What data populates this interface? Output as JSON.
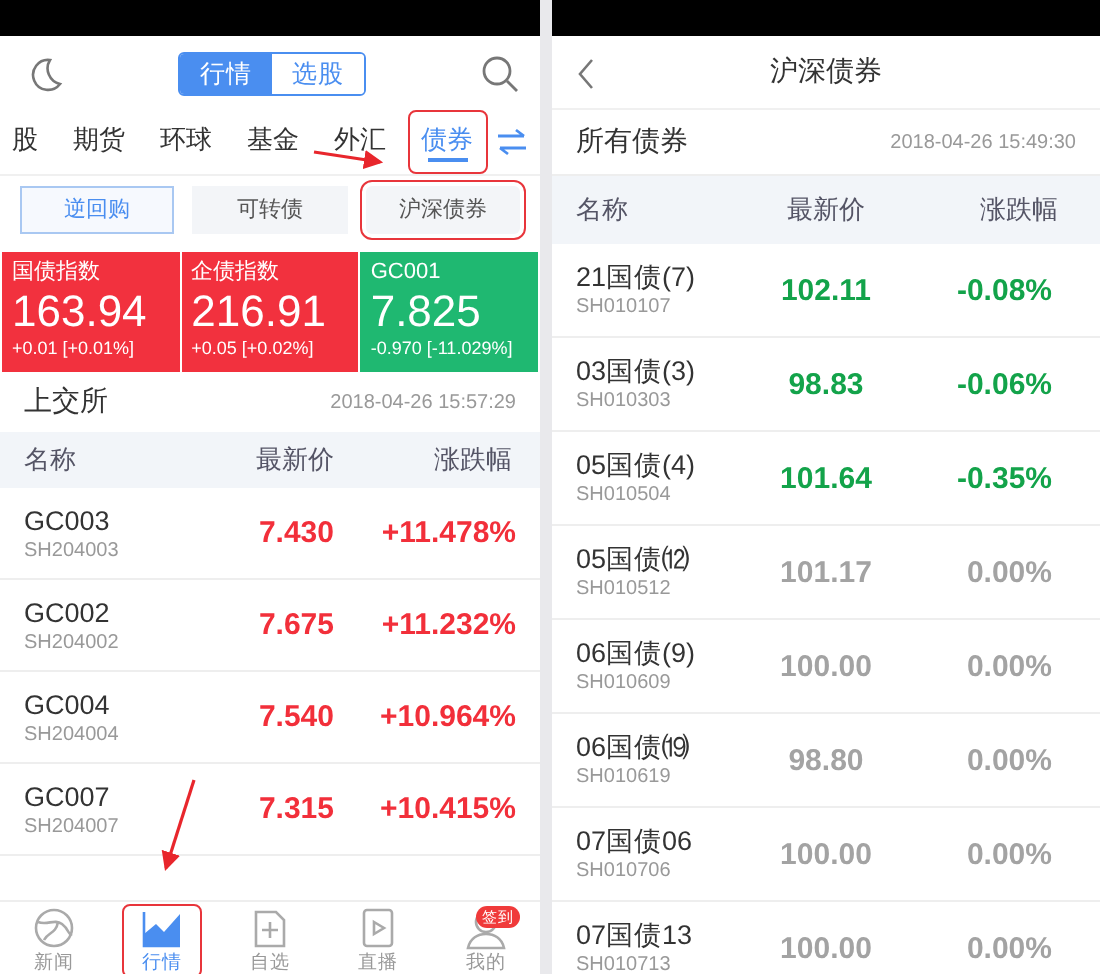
{
  "left": {
    "segments": [
      {
        "label": "行情",
        "selected": true
      },
      {
        "label": "选股",
        "selected": false
      }
    ],
    "categories": [
      {
        "label": "股",
        "selected": false,
        "highlighted": false
      },
      {
        "label": "期货",
        "selected": false,
        "highlighted": false
      },
      {
        "label": "环球",
        "selected": false,
        "highlighted": false
      },
      {
        "label": "基金",
        "selected": false,
        "highlighted": false
      },
      {
        "label": "外汇",
        "selected": false,
        "highlighted": false
      },
      {
        "label": "债券",
        "selected": true,
        "highlighted": true
      }
    ],
    "sub_tabs": [
      {
        "label": "逆回购",
        "selected": true,
        "highlighted": false
      },
      {
        "label": "可转债",
        "selected": false,
        "highlighted": false
      },
      {
        "label": "沪深债券",
        "selected": false,
        "highlighted": true
      }
    ],
    "indices": [
      {
        "name": "国债指数",
        "value": "163.94",
        "change": "+0.01 [+0.01%]",
        "kind": "up"
      },
      {
        "name": "企债指数",
        "value": "216.91",
        "change": "+0.05 [+0.02%]",
        "kind": "up"
      },
      {
        "name": "GC001",
        "value": "7.825",
        "change": "-0.970 [-11.029%]",
        "kind": "down"
      }
    ],
    "section": {
      "title": "上交所",
      "time": "2018-04-26 15:57:29"
    },
    "columns": [
      "名称",
      "最新价",
      "涨跌幅"
    ],
    "rows": [
      {
        "name": "GC003",
        "code": "SH204003",
        "price": "7.430",
        "change": "+11.478%",
        "kind": "up"
      },
      {
        "name": "GC002",
        "code": "SH204002",
        "price": "7.675",
        "change": "+11.232%",
        "kind": "up"
      },
      {
        "name": "GC004",
        "code": "SH204004",
        "price": "7.540",
        "change": "+10.964%",
        "kind": "up"
      },
      {
        "name": "GC007",
        "code": "SH204007",
        "price": "7.315",
        "change": "+10.415%",
        "kind": "up"
      }
    ],
    "nav": [
      {
        "label": "新闻",
        "kind": "globe",
        "selected": false,
        "highlighted": false
      },
      {
        "label": "行情",
        "kind": "chart",
        "selected": true,
        "highlighted": true
      },
      {
        "label": "自选",
        "kind": "add",
        "selected": false,
        "highlighted": false
      },
      {
        "label": "直播",
        "kind": "play",
        "selected": false,
        "highlighted": false
      },
      {
        "label": "我的",
        "kind": "user",
        "badge": "签到",
        "selected": false,
        "highlighted": false
      }
    ]
  },
  "right": {
    "title": "沪深债券",
    "section": {
      "title": "所有债券",
      "time": "2018-04-26 15:49:30"
    },
    "columns": [
      "名称",
      "最新价",
      "涨跌幅"
    ],
    "rows": [
      {
        "name": "21国债(7)",
        "code": "SH010107",
        "price": "102.11",
        "change": "-0.08%",
        "kind": "down"
      },
      {
        "name": "03国债(3)",
        "code": "SH010303",
        "price": "98.83",
        "change": "-0.06%",
        "kind": "down"
      },
      {
        "name": "05国债(4)",
        "code": "SH010504",
        "price": "101.64",
        "change": "-0.35%",
        "kind": "down"
      },
      {
        "name": "05国债⑿",
        "code": "SH010512",
        "price": "101.17",
        "change": "0.00%",
        "kind": "flat"
      },
      {
        "name": "06国债(9)",
        "code": "SH010609",
        "price": "100.00",
        "change": "0.00%",
        "kind": "flat"
      },
      {
        "name": "06国债⒆",
        "code": "SH010619",
        "price": "98.80",
        "change": "0.00%",
        "kind": "flat"
      },
      {
        "name": "07国债06",
        "code": "SH010706",
        "price": "100.00",
        "change": "0.00%",
        "kind": "flat"
      },
      {
        "name": "07国债13",
        "code": "SH010713",
        "price": "100.00",
        "change": "0.00%",
        "kind": "flat"
      }
    ]
  }
}
